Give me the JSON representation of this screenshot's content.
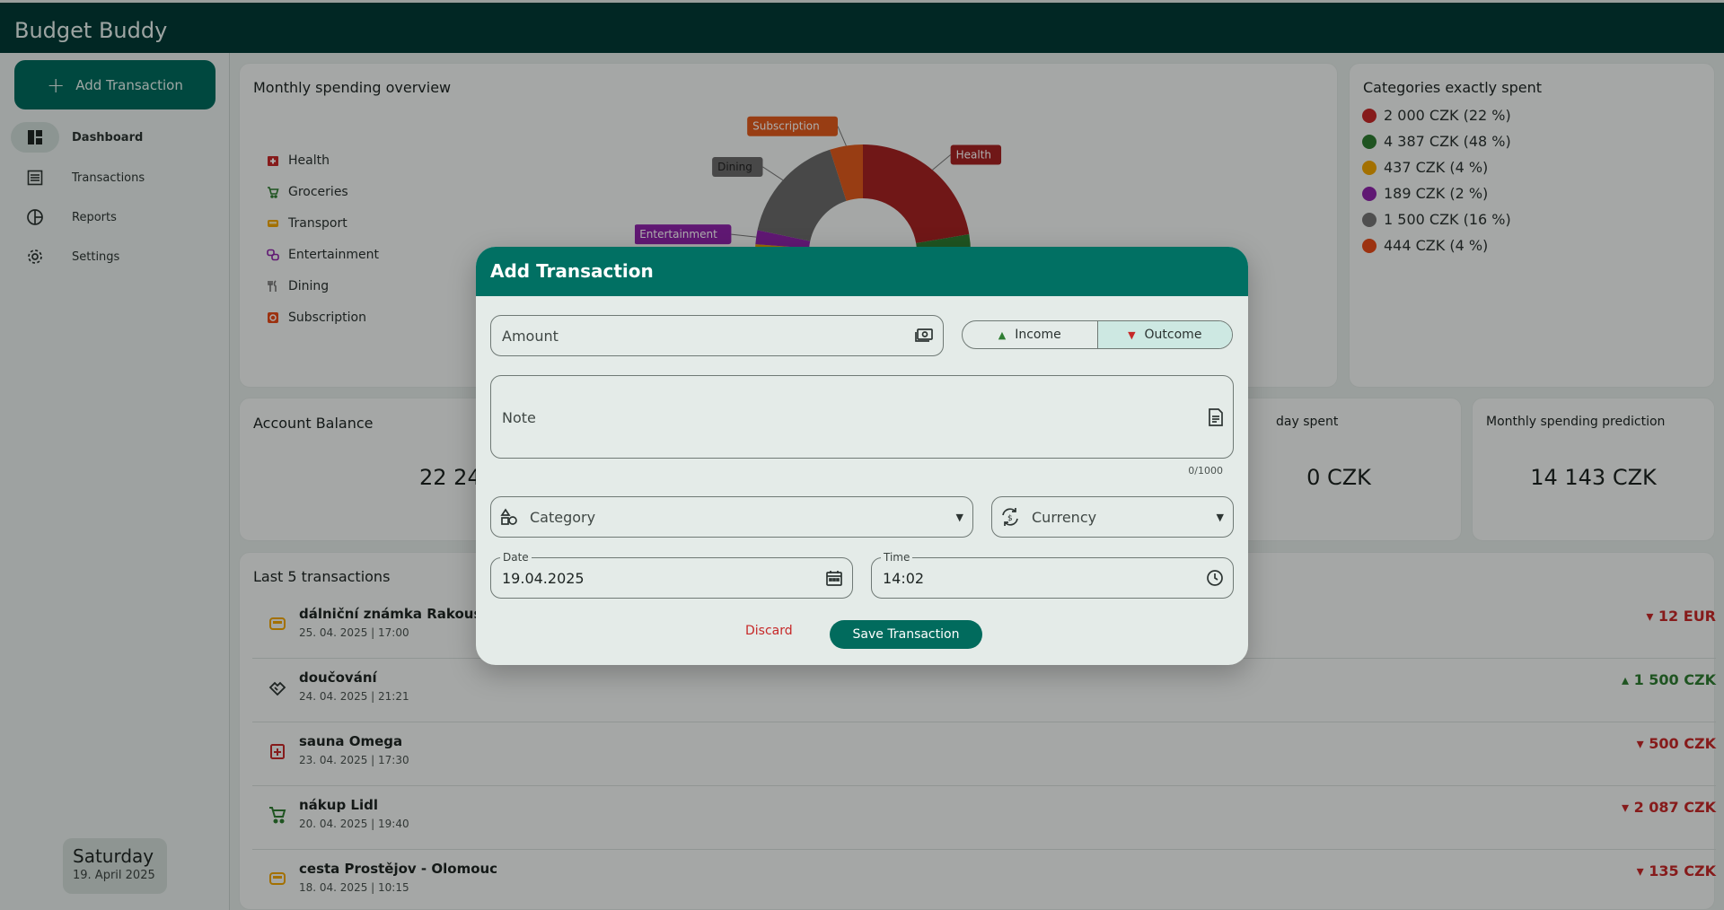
{
  "app": {
    "title": "Budget Buddy"
  },
  "sidebar": {
    "add_label": "Add Transaction",
    "items": [
      {
        "label": "Dashboard",
        "icon": "dashboard-icon"
      },
      {
        "label": "Transactions",
        "icon": "list-icon"
      },
      {
        "label": "Reports",
        "icon": "pie-icon"
      },
      {
        "label": "Settings",
        "icon": "gear-icon"
      }
    ],
    "day": {
      "weekday": "Saturday",
      "date": "19. April 2025"
    }
  },
  "overview": {
    "title": "Monthly spending overview",
    "legend": [
      {
        "label": "Health",
        "color": "#c62828"
      },
      {
        "label": "Groceries",
        "color": "#2e7d32"
      },
      {
        "label": "Transport",
        "color": "#f0a500"
      },
      {
        "label": "Entertainment",
        "color": "#8e24aa"
      },
      {
        "label": "Dining",
        "color": "#757575"
      },
      {
        "label": "Subscription",
        "color": "#e64a19"
      }
    ]
  },
  "chart_data": {
    "type": "pie",
    "categories": [
      "Health",
      "Groceries",
      "Transport",
      "Entertainment",
      "Dining",
      "Subscription"
    ],
    "values": [
      2000,
      4387,
      437,
      189,
      1500,
      444
    ],
    "colors": [
      "#a52323",
      "#2e7d32",
      "#e0a000",
      "#8e24aa",
      "#6b6b6b",
      "#e05a1c"
    ],
    "title": "Monthly spending overview"
  },
  "categories_card": {
    "title": "Categories exactly spent",
    "lines": [
      {
        "text": "2 000 CZK (22 %)",
        "color": "#c62828"
      },
      {
        "text": "4 387 CZK (48 %)",
        "color": "#2e7d32"
      },
      {
        "text": "437 CZK (4 %)",
        "color": "#f0a500"
      },
      {
        "text": "189 CZK (2 %)",
        "color": "#8e24aa"
      },
      {
        "text": "1 500 CZK (16 %)",
        "color": "#757575"
      },
      {
        "text": "444 CZK (4 %)",
        "color": "#e64a19"
      }
    ]
  },
  "stats": {
    "balance": {
      "title": "Account Balance",
      "value": "22 24"
    },
    "today": {
      "title": "day spent",
      "value": "0 CZK"
    },
    "prediction": {
      "title": "Monthly spending prediction",
      "value": "14 143 CZK"
    }
  },
  "transactions": {
    "title": "Last 5 transactions",
    "rows": [
      {
        "name": "dálniční známka Rakousko",
        "meta": "25. 04. 2025 | 17:00",
        "amount": "12 EUR",
        "sign": "neg",
        "icon": "car-icon",
        "color": "#f0a500"
      },
      {
        "name": "doučování",
        "meta": "24. 04. 2025 | 21:21",
        "amount": "1 500 CZK",
        "sign": "pos",
        "icon": "handshake-icon",
        "color": "#2d3533"
      },
      {
        "name": "sauna Omega",
        "meta": "23. 04. 2025 | 17:30",
        "amount": "500 CZK",
        "sign": "neg",
        "icon": "medical-icon",
        "color": "#c62828"
      },
      {
        "name": "nákup Lidl",
        "meta": "20. 04. 2025 | 19:40",
        "amount": "2 087 CZK",
        "sign": "neg",
        "icon": "cart-icon",
        "color": "#2e7d32"
      },
      {
        "name": "cesta Prostějov - Olomouc",
        "meta": "18. 04. 2025 | 10:15",
        "amount": "135 CZK",
        "sign": "neg",
        "icon": "car-icon",
        "color": "#f0a500"
      }
    ]
  },
  "dialog": {
    "title": "Add Transaction",
    "amount_placeholder": "Amount",
    "income_label": "Income",
    "outcome_label": "Outcome",
    "note_placeholder": "Note",
    "note_counter": "0/1000",
    "category_placeholder": "Category",
    "currency_placeholder": "Currency",
    "date_label": "Date",
    "date_value": "19.04.2025",
    "time_label": "Time",
    "time_value": "14:02",
    "discard_label": "Discard",
    "save_label": "Save Transaction"
  }
}
